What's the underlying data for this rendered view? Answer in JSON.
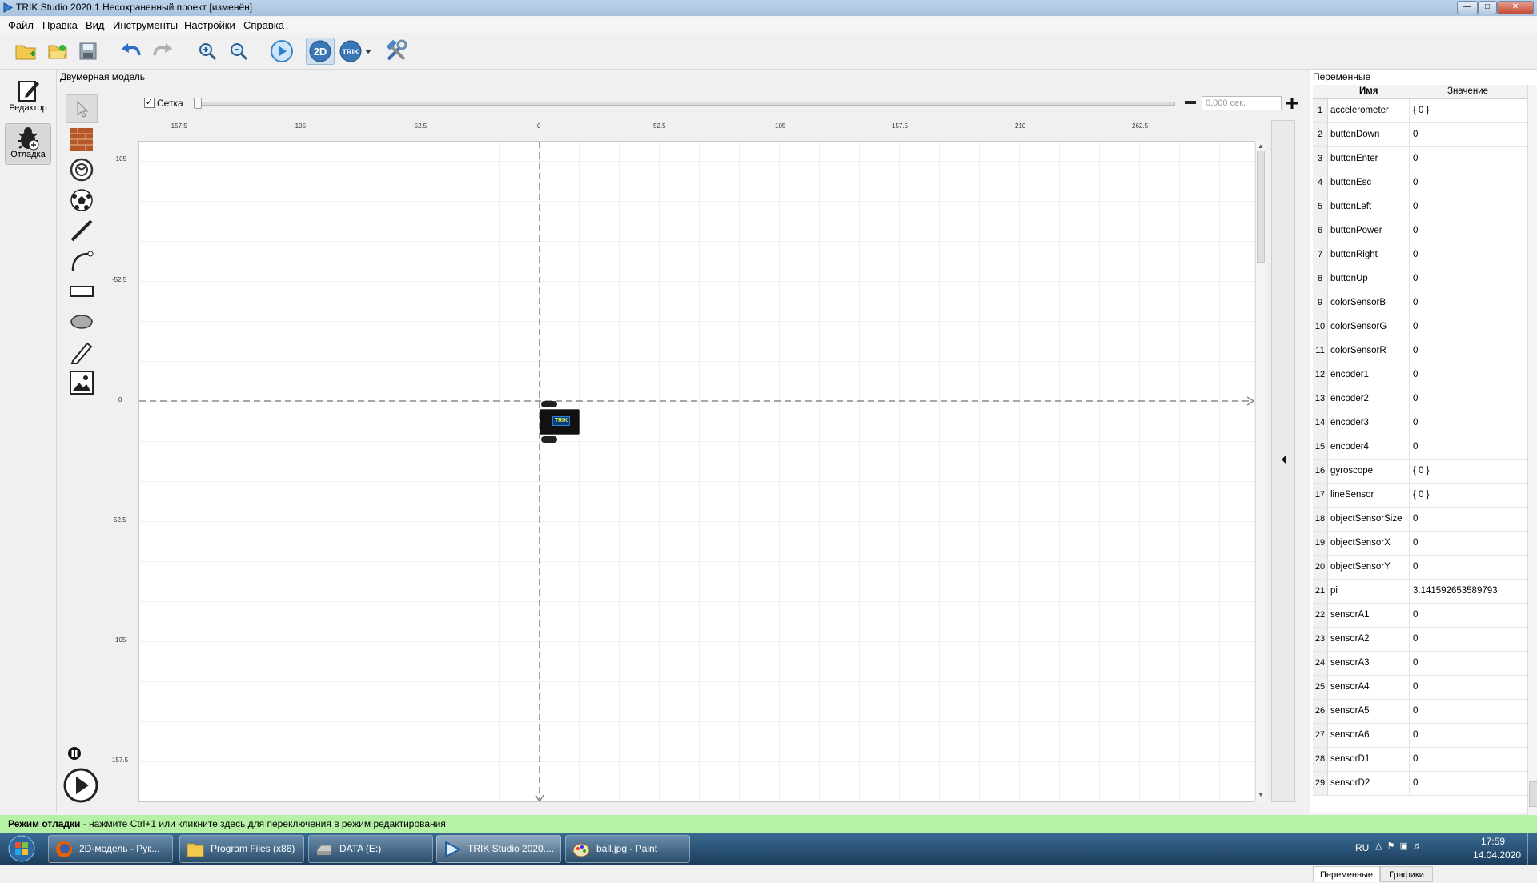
{
  "window": {
    "title": "TRIK Studio 2020.1 Несохраненный проект [изменён]"
  },
  "menu": [
    "Файл",
    "Правка",
    "Вид",
    "Инструменты",
    "Настройки",
    "Справка"
  ],
  "modes": {
    "editor": "Редактор",
    "debug": "Отладка"
  },
  "scene": {
    "title": "Двумерная модель",
    "grid_label": "Сетка",
    "grid_checked": true,
    "time": "0,000 сек.",
    "robot_label": "TRIK",
    "x_ticks": [
      "-157.5",
      "-105",
      "-52.5",
      "0",
      "52.5",
      "105",
      "157.5",
      "210",
      "262.5"
    ],
    "y_ticks": [
      "-105",
      "-52.5",
      "0",
      "52.5",
      "105",
      "157.5"
    ]
  },
  "variables": {
    "title": "Переменные",
    "col_name": "Имя",
    "col_value": "Значение",
    "rows": [
      {
        "n": "1",
        "name": "accelerometer",
        "value": "{ 0 }"
      },
      {
        "n": "2",
        "name": "buttonDown",
        "value": "0"
      },
      {
        "n": "3",
        "name": "buttonEnter",
        "value": "0"
      },
      {
        "n": "4",
        "name": "buttonEsc",
        "value": "0"
      },
      {
        "n": "5",
        "name": "buttonLeft",
        "value": "0"
      },
      {
        "n": "6",
        "name": "buttonPower",
        "value": "0"
      },
      {
        "n": "7",
        "name": "buttonRight",
        "value": "0"
      },
      {
        "n": "8",
        "name": "buttonUp",
        "value": "0"
      },
      {
        "n": "9",
        "name": "colorSensorB",
        "value": "0"
      },
      {
        "n": "10",
        "name": "colorSensorG",
        "value": "0"
      },
      {
        "n": "11",
        "name": "colorSensorR",
        "value": "0"
      },
      {
        "n": "12",
        "name": "encoder1",
        "value": "0"
      },
      {
        "n": "13",
        "name": "encoder2",
        "value": "0"
      },
      {
        "n": "14",
        "name": "encoder3",
        "value": "0"
      },
      {
        "n": "15",
        "name": "encoder4",
        "value": "0"
      },
      {
        "n": "16",
        "name": "gyroscope",
        "value": "{ 0 }"
      },
      {
        "n": "17",
        "name": "lineSensor",
        "value": "{ 0 }"
      },
      {
        "n": "18",
        "name": "objectSensorSize",
        "value": "0"
      },
      {
        "n": "19",
        "name": "objectSensorX",
        "value": "0"
      },
      {
        "n": "20",
        "name": "objectSensorY",
        "value": "0"
      },
      {
        "n": "21",
        "name": "pi",
        "value": "3.141592653589793"
      },
      {
        "n": "22",
        "name": "sensorA1",
        "value": "0"
      },
      {
        "n": "23",
        "name": "sensorA2",
        "value": "0"
      },
      {
        "n": "24",
        "name": "sensorA3",
        "value": "0"
      },
      {
        "n": "25",
        "name": "sensorA4",
        "value": "0"
      },
      {
        "n": "26",
        "name": "sensorA5",
        "value": "0"
      },
      {
        "n": "27",
        "name": "sensorA6",
        "value": "0"
      },
      {
        "n": "28",
        "name": "sensorD1",
        "value": "0"
      },
      {
        "n": "29",
        "name": "sensorD2",
        "value": "0"
      }
    ],
    "tabs": [
      "Переменные",
      "Графики"
    ]
  },
  "status": {
    "bold": "Режим отладки",
    "text": " - нажмите Ctrl+1 или кликните здесь для переключения в режим редактирования"
  },
  "taskbar": {
    "items": [
      {
        "label": "2D-модель - Рук...",
        "icon": "firefox-icon"
      },
      {
        "label": "Program Files (x86)",
        "icon": "folder-icon"
      },
      {
        "label": "DATA (E:)",
        "icon": "drive-icon"
      },
      {
        "label": "TRIK Studio 2020....",
        "icon": "trik-icon"
      },
      {
        "label": "ball.jpg - Paint",
        "icon": "paint-icon"
      }
    ],
    "lang": "RU",
    "time": "17:59",
    "date": "14.04.2020"
  }
}
